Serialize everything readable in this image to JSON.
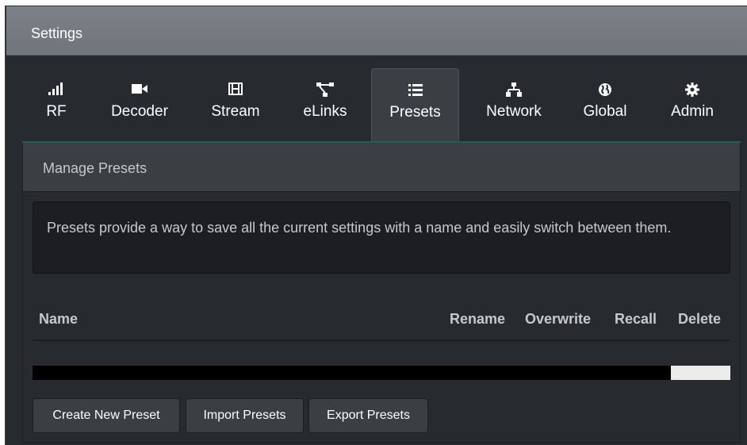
{
  "header": {
    "title": "Settings"
  },
  "tabs": [
    {
      "label": "RF",
      "icon": "signal-icon"
    },
    {
      "label": "Decoder",
      "icon": "video-camera-icon"
    },
    {
      "label": "Stream",
      "icon": "film-icon"
    },
    {
      "label": "eLinks",
      "icon": "network-nodes-icon"
    },
    {
      "label": "Presets",
      "icon": "list-icon",
      "active": true
    },
    {
      "label": "Network",
      "icon": "sitemap-icon"
    },
    {
      "label": "Global",
      "icon": "globe-icon"
    },
    {
      "label": "Admin",
      "icon": "gear-icon"
    }
  ],
  "panel": {
    "title": "Manage Presets",
    "info": "Presets provide a way to save all the current settings with a name and easily switch between them.",
    "columns": {
      "name": "Name",
      "rename": "Rename",
      "overwrite": "Overwrite",
      "recall": "Recall",
      "delete": "Delete"
    },
    "progress_fraction": 0.915,
    "buttons": {
      "create": "Create New Preset",
      "import": "Import Presets",
      "export": "Export Presets"
    }
  },
  "colors": {
    "background": "#272b30",
    "header": "#7a8085",
    "active_tab": "#3a3f44",
    "tab_underline": "#1f5e5a",
    "text": "#ffffff"
  }
}
